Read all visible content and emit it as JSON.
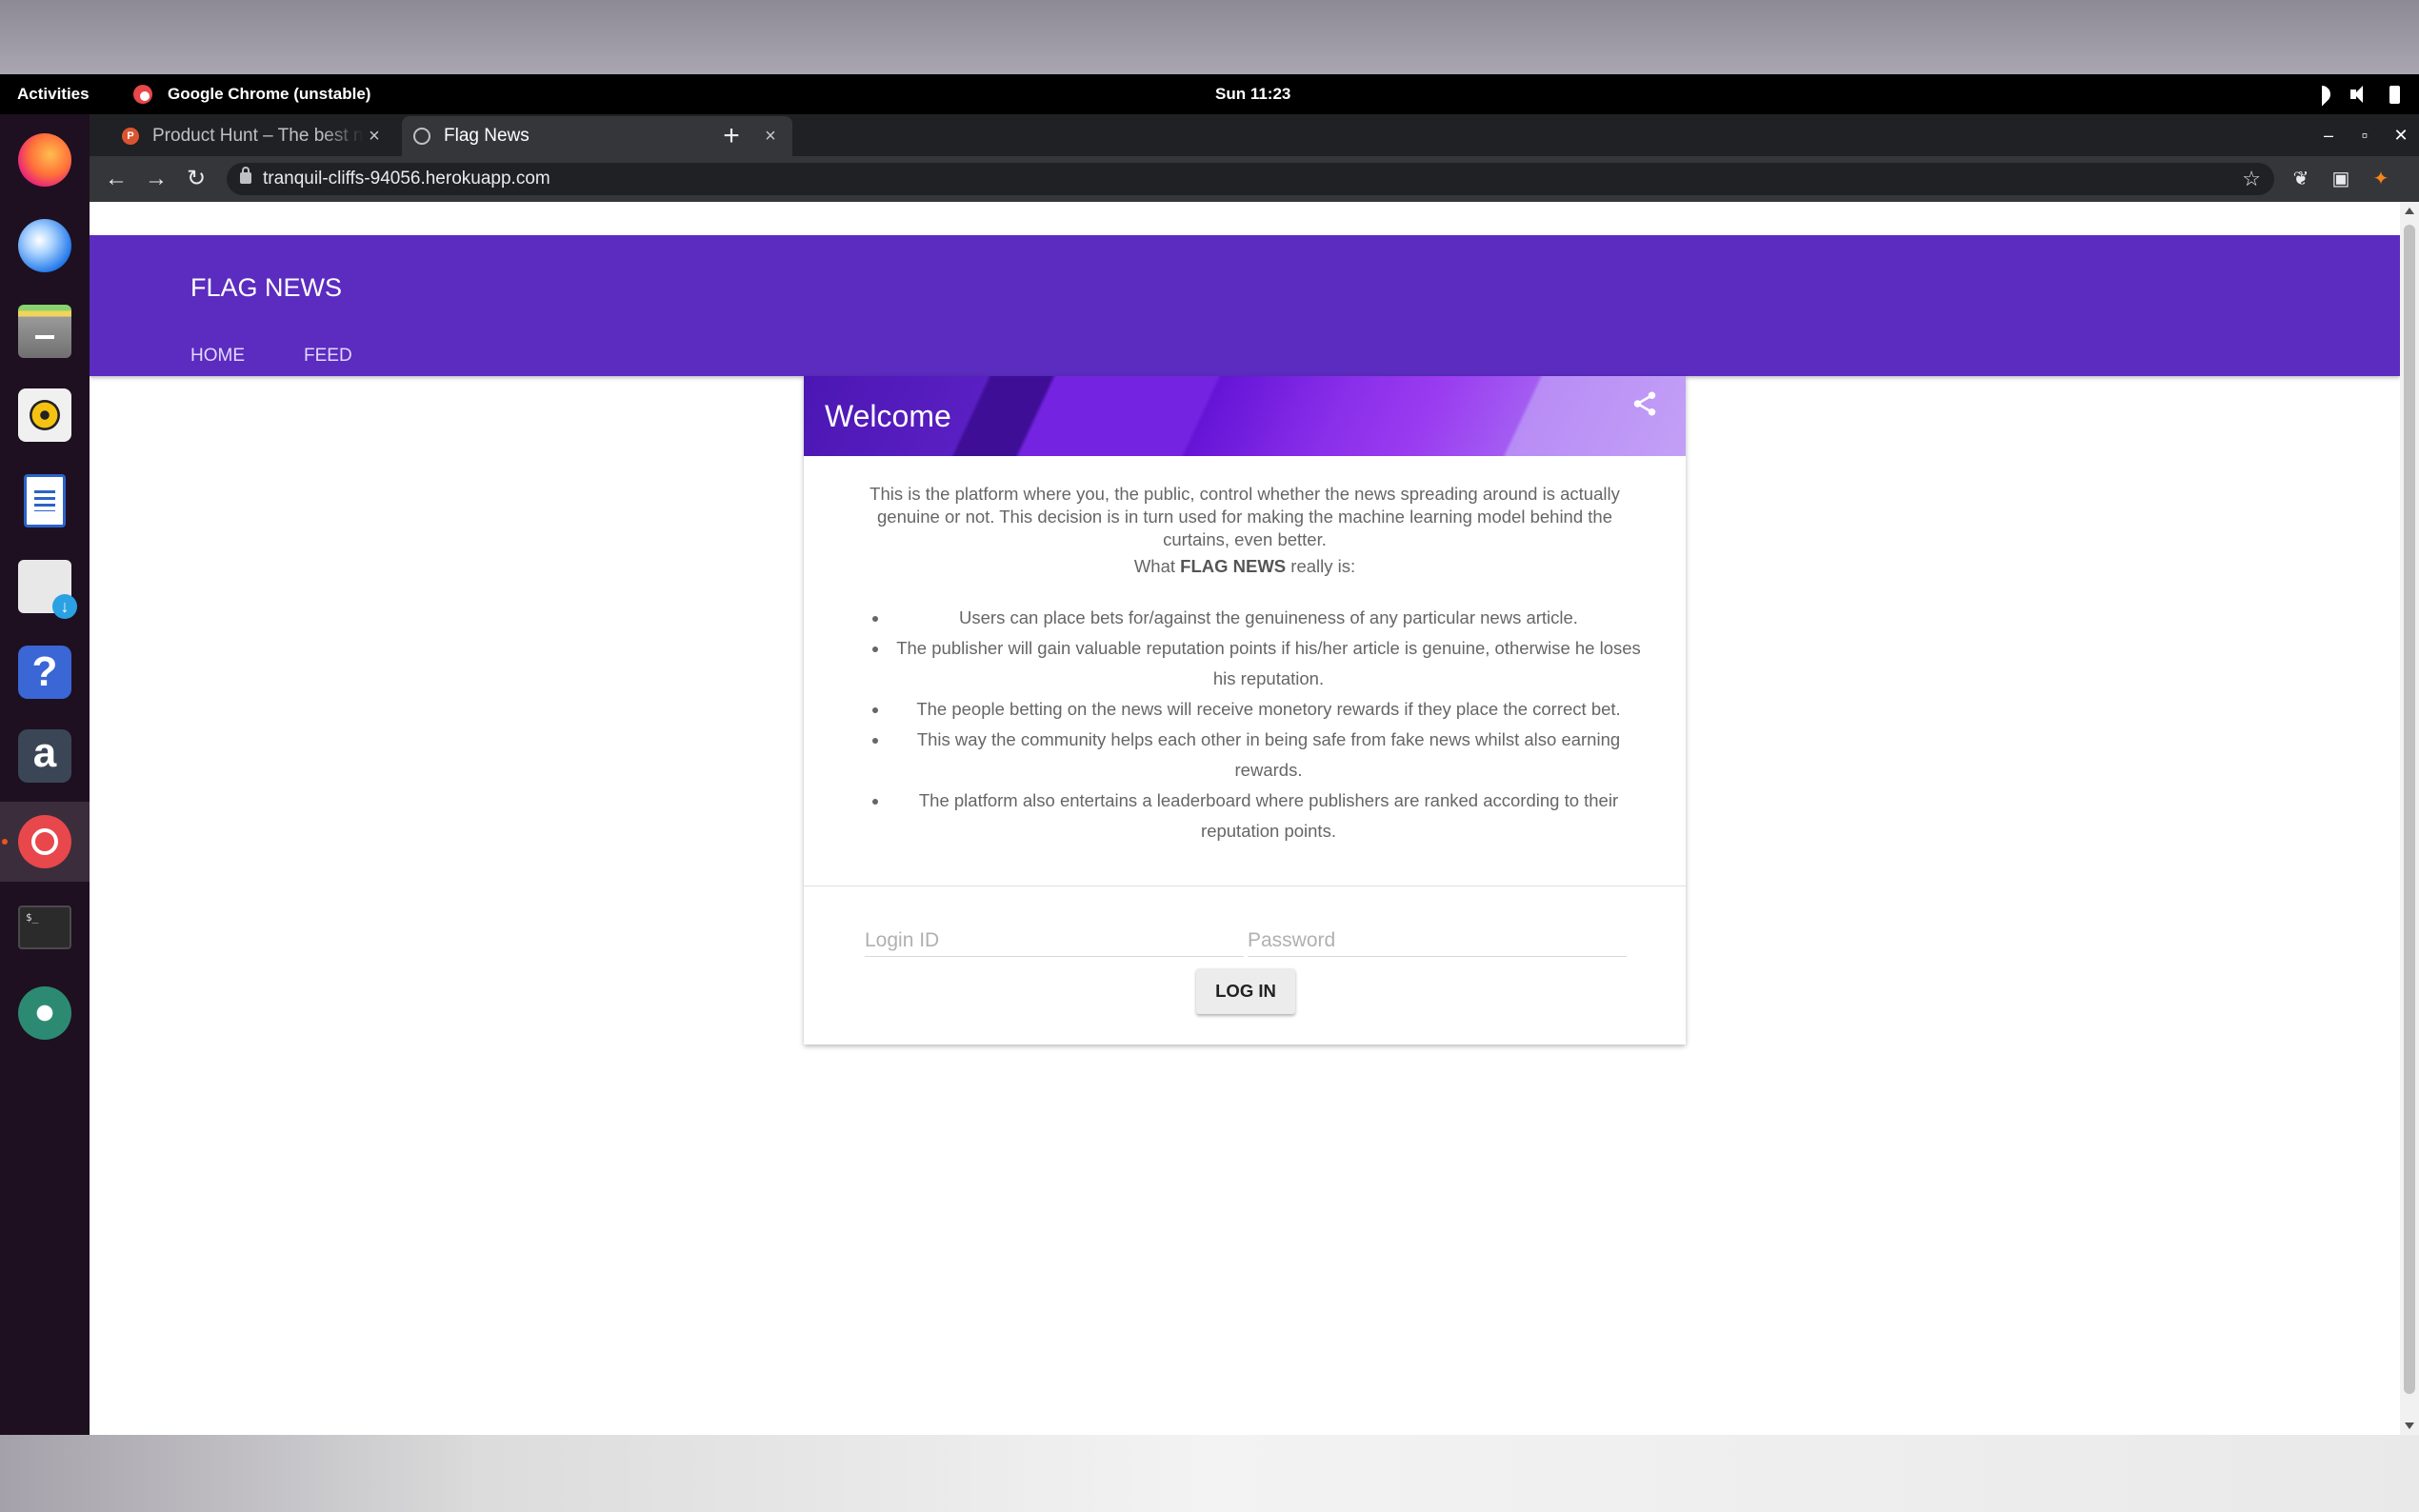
{
  "desktop": {
    "activities": "Activities",
    "app_name": "Google Chrome (unstable)",
    "clock": "Sun 11:23",
    "dock_items": [
      "firefox-icon",
      "thunderbird-icon",
      "files-icon",
      "rhythmbox-icon",
      "writer-icon",
      "software-icon",
      "help-icon",
      "amazon-icon",
      "chrome-icon",
      "terminal-icon",
      "settings-icon"
    ],
    "tray_icons": [
      "wifi-icon",
      "volume-icon",
      "battery-icon"
    ]
  },
  "browser": {
    "tabs": [
      {
        "title": "Product Hunt – The best new products in tech.",
        "favicon": "P",
        "active": false
      },
      {
        "title": "Flag News",
        "active": true
      }
    ],
    "tab_close": "×",
    "new_tab": "+",
    "url": "tranquil-cliffs-94056.herokuapp.com"
  },
  "site": {
    "brand": "FLAG NEWS",
    "nav": [
      "HOME",
      "FEED"
    ]
  },
  "card": {
    "title": "Welcome",
    "intro": "This is the platform where you, the public, control whether the news spreading around is actually genuine or not. This decision is in turn used for making the machine learning model behind the curtains, even better.",
    "what_prefix": "What",
    "what_brand": "FLAG NEWS",
    "what_suffix": "really is:",
    "bullets": [
      "Users can place bets for/against the genuineness of any particular news article.",
      "The publisher will gain valuable reputation points if his/her article is genuine, otherwise he loses his reputation.",
      "The people betting on the news will receive monetory rewards if they place the correct bet.",
      "This way the community helps each other in being safe from fake news whilst also earning rewards.",
      "The platform also entertains a leaderboard where publishers are ranked according to their reputation points."
    ],
    "login_placeholder": "Login ID",
    "password_placeholder": "Password",
    "login_button": "LOG IN"
  },
  "colors": {
    "header_purple": "#5b2cbf",
    "dock_bg": "#1e1020",
    "browser_dark": "#202124"
  }
}
